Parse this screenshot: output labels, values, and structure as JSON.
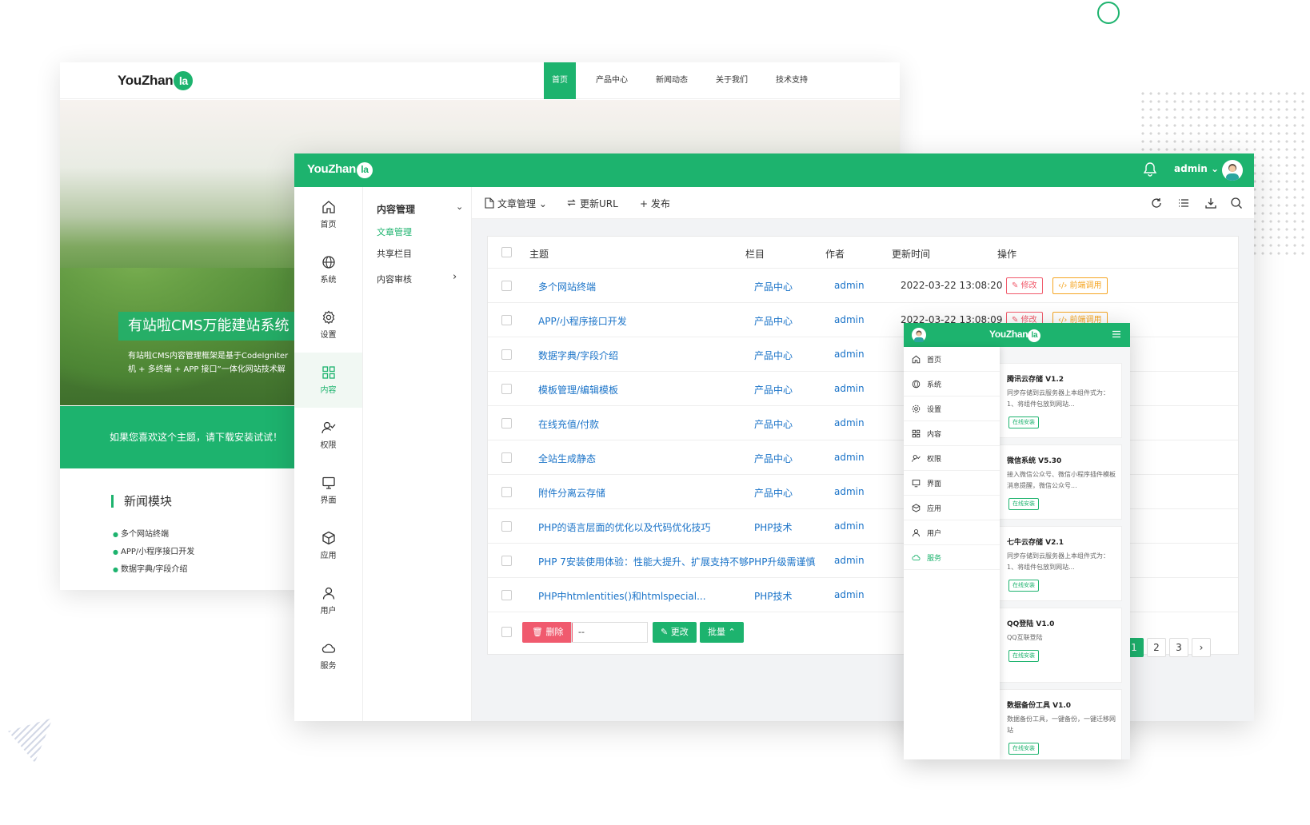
{
  "site": {
    "logo_text": "YouZhan",
    "logo_badge": "la",
    "nav": [
      "首页",
      "产品中心",
      "新闻动态",
      "关于我们",
      "技术支持"
    ],
    "hero_title": "有站啦CMS万能建站系统",
    "hero_desc": "有站啦CMS内容管理框架是基于CodeIgniter机 + 多终端 + APP 接口”一体化网站技术解",
    "band_text": "如果您喜欢这个主题，请下载安装试试！",
    "news_title": "新闻模块",
    "news_items": [
      "多个网站终端",
      "APP/小程序接口开发",
      "数据字典/字段介绍"
    ]
  },
  "admin": {
    "logo_text": "YouZhan",
    "logo_badge": "la",
    "user": "admin ⌄",
    "rail": [
      "首页",
      "系统",
      "设置",
      "内容",
      "权限",
      "界面",
      "应用",
      "用户",
      "服务"
    ],
    "subnav": {
      "head": "内容管理",
      "head_arrow": "⌄",
      "items": [
        "文章管理",
        "共享栏目",
        "内容审核"
      ],
      "item_arrow": "›"
    },
    "toolbar": {
      "article": "文章管理 ⌄",
      "update_url": "更新URL",
      "publish": "+ 发布"
    },
    "table": {
      "headers": [
        "主题",
        "栏目",
        "作者",
        "更新时间",
        "操作"
      ],
      "edit_label": "修改",
      "front_label": "前端调用",
      "rows": [
        {
          "subject": "多个网站终端",
          "category": "产品中心",
          "author": "admin",
          "time": "2022-03-22 13:08:20"
        },
        {
          "subject": "APP/小程序接口开发",
          "category": "产品中心",
          "author": "admin",
          "time": "2022-03-22 13:08:09"
        },
        {
          "subject": "数据字典/字段介绍",
          "category": "产品中心",
          "author": "admin",
          "time": ""
        },
        {
          "subject": "模板管理/编辑模板",
          "category": "产品中心",
          "author": "admin",
          "time": ""
        },
        {
          "subject": "在线充值/付款",
          "category": "产品中心",
          "author": "admin",
          "time": ""
        },
        {
          "subject": "全站生成静态",
          "category": "产品中心",
          "author": "admin",
          "time": ""
        },
        {
          "subject": "附件分离云存储",
          "category": "产品中心",
          "author": "admin",
          "time": ""
        },
        {
          "subject": "PHP的语言层面的优化以及代码优化技巧",
          "category": "PHP技术",
          "author": "admin",
          "time": ""
        },
        {
          "subject": "PHP 7安装使用体验：性能大提升、扩展支持不够PHP升级需谨慎",
          "category": "",
          "author": "admin",
          "time": ""
        },
        {
          "subject": "PHP中htmlentities()和htmlspecial...",
          "category": "PHP技术",
          "author": "admin",
          "time": ""
        }
      ]
    },
    "footer": {
      "delete": "删除",
      "select_value": "--",
      "change": "更改",
      "batch": "批量 ⌃"
    },
    "pager": {
      "prev": "‹",
      "pages": [
        "1",
        "2",
        "3"
      ],
      "next": "›"
    }
  },
  "mobile": {
    "logo_text": "YouZhan",
    "logo_badge": "la",
    "menu": [
      "首页",
      "系统",
      "设置",
      "内容",
      "权限",
      "界面",
      "应用",
      "用户",
      "服务"
    ],
    "cards": [
      {
        "title": "腾讯云存储 V1.2",
        "desc": "同步存储到云服务器上本组件式为：1、将组件包放到网站...",
        "button": "在线安装"
      },
      {
        "title": "微信系统 V5.30",
        "desc": "接入微信公众号、微信小程序插件模板消息提醒，微信公众号...",
        "button": "在线安装"
      },
      {
        "title": "七牛云存储 V2.1",
        "desc": "同步存储到云服务器上本组件式为：1、将组件包放到网站...",
        "button": "在线安装"
      },
      {
        "title": "QQ登陆 V1.0",
        "desc": "QQ互联登陆",
        "button": "在线安装"
      },
      {
        "title": "数据备份工具 V1.0",
        "desc": "数据备份工具，一键备份，一键迁移网站",
        "button": "在线安装"
      }
    ]
  },
  "colors": {
    "brand": "#1db36e",
    "danger": "#f05a6e",
    "warning": "#f5a623",
    "link": "#1a73c8"
  }
}
